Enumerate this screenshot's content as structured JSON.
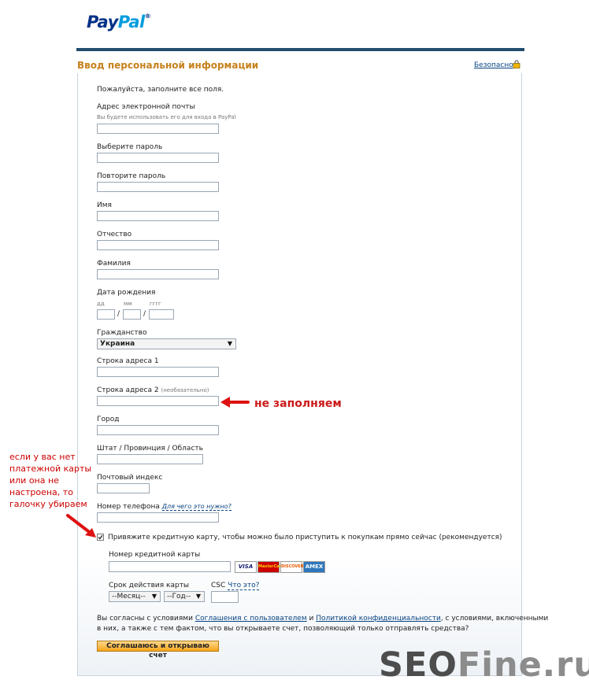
{
  "brand": {
    "logo_pay": "Pay",
    "logo_pal": "Pal",
    "logo_tm": "®"
  },
  "header": {
    "title": "Ввод персональной информации",
    "secure_label": "Безопасно"
  },
  "form": {
    "intro": "Пожалуйста, заполните все поля.",
    "email": {
      "label": "Адрес электронной почты",
      "hint": "Вы будете использовать его для входа в PayPal",
      "value": ""
    },
    "password": {
      "label": "Выберите пароль",
      "value": ""
    },
    "password_confirm": {
      "label": "Повторите пароль",
      "value": ""
    },
    "first_name": {
      "label": "Имя",
      "value": ""
    },
    "middle_name": {
      "label": "Отчество",
      "value": ""
    },
    "last_name": {
      "label": "Фамилия",
      "value": ""
    },
    "birth_date": {
      "label": "Дата рождения",
      "day_hint": "дд",
      "month_hint": "мм",
      "year_hint": "гггг",
      "separator": "/"
    },
    "citizenship": {
      "label": "Гражданство",
      "selected": "Украина"
    },
    "address1": {
      "label": "Строка адреса 1",
      "value": ""
    },
    "address2": {
      "label": "Строка адреса 2",
      "optional": "(необязательно)",
      "value": ""
    },
    "city": {
      "label": "Город",
      "value": ""
    },
    "state": {
      "label": "Штат / Провинция / Область",
      "value": ""
    },
    "postal": {
      "label": "Почтовый индекс",
      "value": ""
    },
    "phone": {
      "label": "Номер телефона",
      "why_link": "Для чего это нужно?",
      "value": ""
    },
    "link_card": {
      "label": "Привяжите кредитную карту, чтобы можно было приступить к покупкам прямо сейчас (рекомендуется)",
      "checked": true
    },
    "card_number": {
      "label": "Номер кредитной карты",
      "value": ""
    },
    "card_logos": [
      "VISA",
      "MasterCard",
      "DISCOVER",
      "AMEX"
    ],
    "expiry": {
      "label": "Срок действия карты",
      "month": "--Месяц--",
      "year": "--Год--"
    },
    "csc": {
      "label": "CSC",
      "what_link": "Что это?",
      "value": ""
    },
    "terms": {
      "part1": "Вы согласны с условиями ",
      "user_agreement": "Соглашения с пользователем",
      "and": " и ",
      "privacy": "Политикой конфиденциальности",
      "part2": ", с условиями, включенными",
      "line2": "в них, а также с тем фактом, что вы открываете счет, позволяющий только отправлять средства?"
    },
    "submit_label": "Соглашаюсь и открываю счет"
  },
  "annotations": {
    "left_note": [
      "если у вас нет",
      "платежной карты",
      "или она не",
      "настроена, то",
      "галочку убираем"
    ],
    "right_note": "не заполняем"
  },
  "watermark": {
    "part1": "SEO",
    "part2": "Fine.ru"
  },
  "colors": {
    "accent": "#c6811c",
    "link": "#084482",
    "note": "#cc0000",
    "brand_blue": "#003087"
  }
}
